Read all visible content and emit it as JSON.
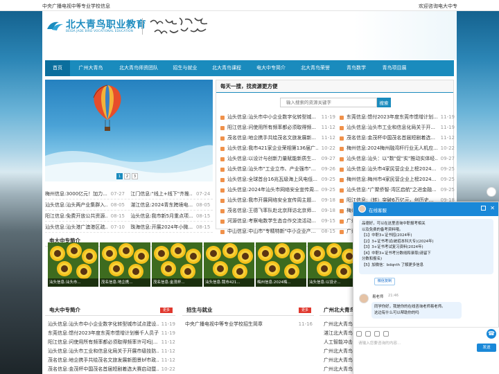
{
  "topbar": {
    "left": "中央广播电视中等专业学校信息",
    "right": "欢迎咨询电大中专"
  },
  "brand": {
    "name_cn": "北大青鸟职业教育",
    "name_en": "BEIDA JADE BIRD VOCATIONAL EDUCATION",
    "registered": "®",
    "accent": "#1a8bbd"
  },
  "nav": [
    {
      "label": "首页",
      "w": 36,
      "active": true
    },
    {
      "label": "广州大青鸟",
      "w": 60
    },
    {
      "label": "北大青鸟师资团队",
      "w": 78
    },
    {
      "label": "招生与就业",
      "w": 56
    },
    {
      "label": "北大青鸟课程",
      "w": 64
    },
    {
      "label": "电大中专简介",
      "w": 64
    },
    {
      "label": "北大青鸟荣誉",
      "w": 64
    },
    {
      "label": "青鸟数学",
      "w": 54
    },
    {
      "label": "青鸟项目展",
      "w": 56
    }
  ],
  "slider": {
    "pages": [
      "1",
      "2",
      "3"
    ],
    "current": "1"
  },
  "ticker": [
    [
      "梅州信息:3000亿元！加力...",
      "07-27",
      "江门信息:\"线上+线下\"齐推...",
      "07-24"
    ],
    [
      "汕头信息:汕头两产业集群入...",
      "08-05",
      "湛江信息:2024青东跨境电...",
      "08-05"
    ],
    [
      "阳江信息:免费开放公共资源...",
      "08-15",
      "汕头信息:我市新5月重点项...",
      "08-15"
    ],
    [
      "汕头信息:汕头港广澳港区疏...",
      "07-10",
      "珠海信息:开展2024年小微...",
      "08-15"
    ]
  ],
  "search": {
    "title": "每天一搜，找资源更方便",
    "placeholder": "输入搜索的资源关键字",
    "button": "搜索"
  },
  "news_left": [
    [
      "汕头信息:汕头市中小企业数字化转型城...",
      "11-19"
    ],
    [
      "阳江信息:问使用所有频率都必须取得频...",
      "11-12"
    ],
    [
      "茂名信息:地企携手共绘茂名文旅发展新...",
      "11-12"
    ],
    [
      "汕头信息:我市421家企业荣相第136届广...",
      "10-22"
    ],
    [
      "汕头信息:以设计与创新力量赋能新质生...",
      "09-27"
    ],
    [
      "汕头信息:汕头市\"工业立市、产业强市\"...",
      "09-26"
    ],
    [
      "汕头信息:全球首台16兆瓦级海上风电低...",
      "09-25"
    ],
    [
      "汕头信息:2024年汕头市网络安全宣传周...",
      "09-25"
    ],
    [
      "汕头信息:我市开展网络安全宣传周主题...",
      "09-18"
    ],
    [
      "茂名信息:王德飞率队赴北京拜访北京师...",
      "09-18"
    ],
    [
      "河源信息:考察电数学生态合作交流活动...",
      "09-15"
    ],
    [
      "中山信息:中山市\"专精特新\"中小企业产...",
      "08-15"
    ]
  ],
  "news_right": [
    [
      "东莞信息:馈付2023年度东莞市馈增计划...",
      "11-19"
    ],
    [
      "汕头信息:汕头市工业和信息化局关于开...",
      "11-19"
    ],
    [
      "茂名信息:金茂杯中国茂名首届短剧着选...",
      "11-12"
    ],
    [
      "梅州信息:2024梅州融湾杆行业无人机应...",
      "10-22"
    ],
    [
      "汕头信息:汕头：以\"数\"促\"实\"推动实体经...",
      "09-27"
    ],
    [
      "汕头信息:汕头市4家民营企业上榜2024...",
      "09-25"
    ],
    [
      "梅州信息:梅州市4家民营企业上榜2024...",
      "09-25"
    ],
    [
      "汕头信息:\"广聚侨智·湾区启航\"之进金融...",
      "09-25"
    ],
    [
      "阳江信息:（转）突破6万亿元，创历史...",
      "09-18"
    ],
    [
      "梅州信息:广东两个案例入选《国家数字...",
      "09-18"
    ],
    [
      "广州信息:...",
      "09-15"
    ],
    [
      "广州信息:...",
      "08-15"
    ]
  ],
  "intro_title": "电大中专简介",
  "thumbs": [
    "汕头信息:汕头市...",
    "茂名信息:地企携...",
    "茂名信息:金茂杯...",
    "汕头信息:我市421...",
    "梅州信息:2024梅...",
    "汕头信息:以设计...",
    "汕头信息:..."
  ],
  "box1": {
    "title": "电大中专简介",
    "more": "更多",
    "items": [
      [
        "汕头信息:汕头市中小企业数字化转型城市试点建设...",
        "11-19"
      ],
      [
        "东莞信息:馈付2023年度东莞市馈增计划餐千人员子...",
        "11-19"
      ],
      [
        "阳江信息:问使用所有频率都必须取得频率许可吗|...",
        "11-12"
      ],
      [
        "汕头信息:汕头市工业和信息化局关于开展市级技防...",
        "11-12"
      ],
      [
        "茂名信息:地企携手共绘茂名文旅发展新图景bf市政...",
        "11-12"
      ],
      [
        "茂名信息:金茂杯中国茂名首届短剧着选大赛启动暨...",
        "10-22"
      ]
    ]
  },
  "box2": {
    "title": "招生与就业",
    "more": "更多",
    "items": [
      [
        "中央广播电视中等专业学校招生简章",
        "11-16"
      ]
    ]
  },
  "box3": {
    "title": "广州北大青鸟",
    "items": [
      "广州北大青鸟日...",
      "湛江北大青鸟...",
      "人工智能冲击...",
      "广州北大青鸟...",
      "广州北大青鸟...",
      "广州北大青鸟..."
    ]
  },
  "chat": {
    "title": "在线客服",
    "welcome_lines": [
      "品德好，可以在这里咨询中职报考相关",
      "以及免费的备考资料哦。",
      "【1】中职3+证书招(2024年)",
      "【2】3+证书考试(统招本科大专)(2024年)",
      "【3】3+证书考试复习资料(2024年)",
      "【4】中职3+证书考分数线和录取(请留下",
      "分数和报名)",
      "【5】加微信：bdqnth 了解更多信息"
    ],
    "copy_button": "微信复制",
    "agent_name": "易老师",
    "agent_time": "21:46",
    "agent_msg_1": "同学你好，我是你的在线咨询老师易老师。",
    "agent_msg_2": "这边有什么可以帮助你的吗",
    "input_placeholder": "请输入您要咨询的内容...",
    "send": "发送"
  }
}
